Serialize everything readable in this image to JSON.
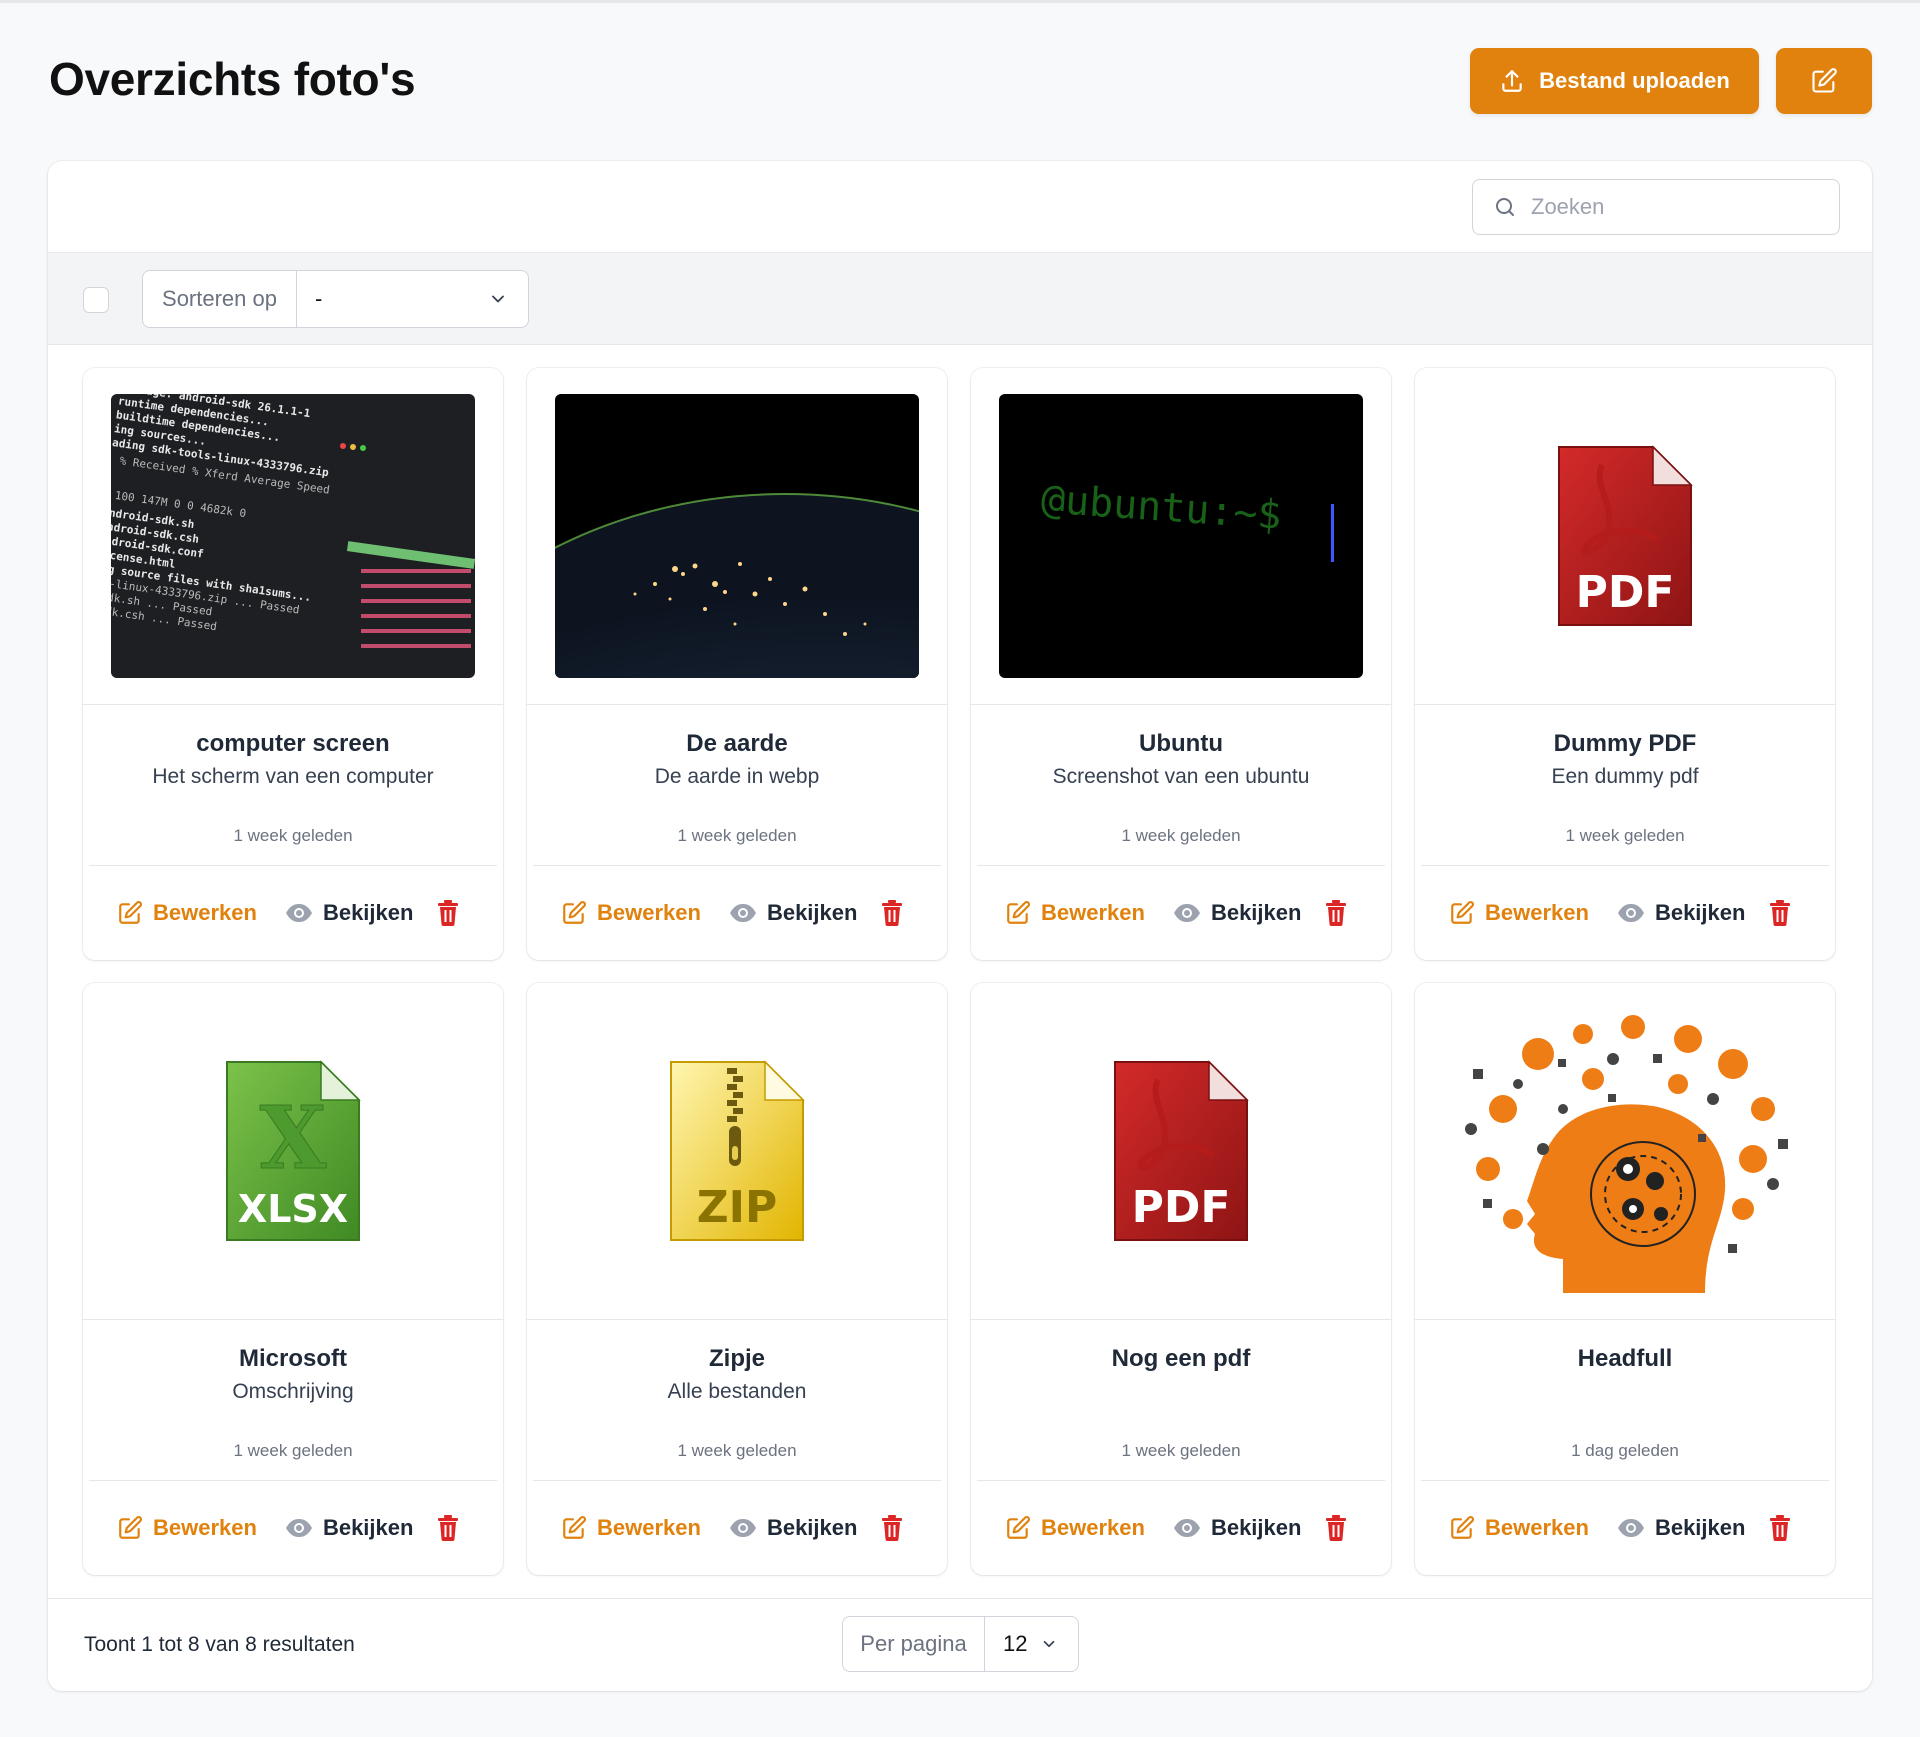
{
  "header": {
    "title": "Overzichts foto's",
    "upload_button": "Bestand uploaden",
    "accent": "#e0820d"
  },
  "search": {
    "placeholder": "Zoeken"
  },
  "toolbar": {
    "sort_label": "Sorteren op",
    "sort_value": "-"
  },
  "actions": {
    "edit": "Bewerken",
    "view": "Bekijken"
  },
  "cards": [
    {
      "title": "computer screen",
      "description": "Het scherm van een computer",
      "time": "1 week geleden",
      "thumb": "terminal-screenshot"
    },
    {
      "title": "De aarde",
      "description": "De aarde in webp",
      "time": "1 week geleden",
      "thumb": "earth-at-night"
    },
    {
      "title": "Ubuntu",
      "description": "Screenshot van een ubuntu",
      "time": "1 week geleden",
      "thumb": "ubuntu-prompt",
      "prompt_text": "@ubuntu:~$"
    },
    {
      "title": "Dummy PDF",
      "description": "Een dummy pdf",
      "time": "1 week geleden",
      "thumb": "pdf-file-icon",
      "badge": "PDF"
    },
    {
      "title": "Microsoft",
      "description": "Omschrijving",
      "time": "1 week geleden",
      "thumb": "xlsx-file-icon",
      "badge": "XLSX"
    },
    {
      "title": "Zipje",
      "description": "Alle bestanden",
      "time": "1 week geleden",
      "thumb": "zip-file-icon",
      "badge": "ZIP"
    },
    {
      "title": "Nog een pdf",
      "description": "",
      "time": "1 week geleden",
      "thumb": "pdf-file-icon",
      "badge": "PDF"
    },
    {
      "title": "Headfull",
      "description": "",
      "time": "1 dag geleden",
      "thumb": "head-gears-illustration"
    }
  ],
  "footer": {
    "results": "Toont 1 tot 8 van 8 resultaten",
    "per_page_label": "Per pagina",
    "per_page_value": "12"
  }
}
